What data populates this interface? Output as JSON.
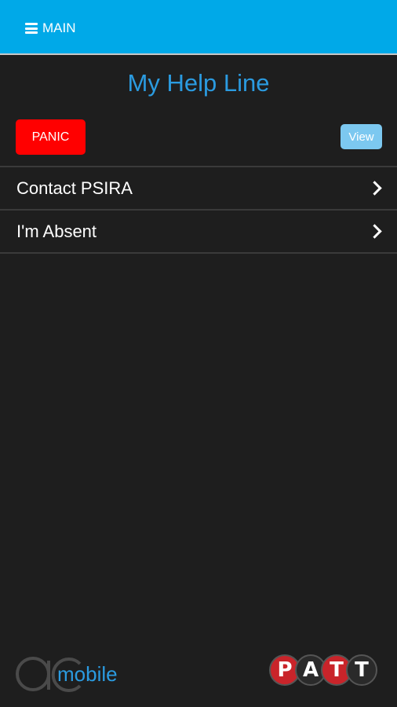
{
  "header": {
    "menu_label": "MAIN"
  },
  "page": {
    "title": "My Help Line"
  },
  "actions": {
    "panic_label": "PANIC",
    "view_label": "View"
  },
  "list": {
    "items": [
      {
        "label": "Contact PSIRA"
      },
      {
        "label": "I'm Absent"
      }
    ]
  },
  "footer": {
    "left_logo": {
      "letters": "ac",
      "text": "mobile"
    },
    "right_logo": {
      "letters": [
        "P",
        "A",
        "T",
        "T"
      ]
    }
  },
  "colors": {
    "header_bg": "#00a9e8",
    "title": "#2b9be0",
    "panic": "#ff0000",
    "view": "#7cc8f0",
    "background": "#1e1e1e",
    "logo_red": "#c9242a"
  },
  "icons": {
    "menu": "hamburger-icon",
    "row_arrow": "chevron-right-icon"
  }
}
